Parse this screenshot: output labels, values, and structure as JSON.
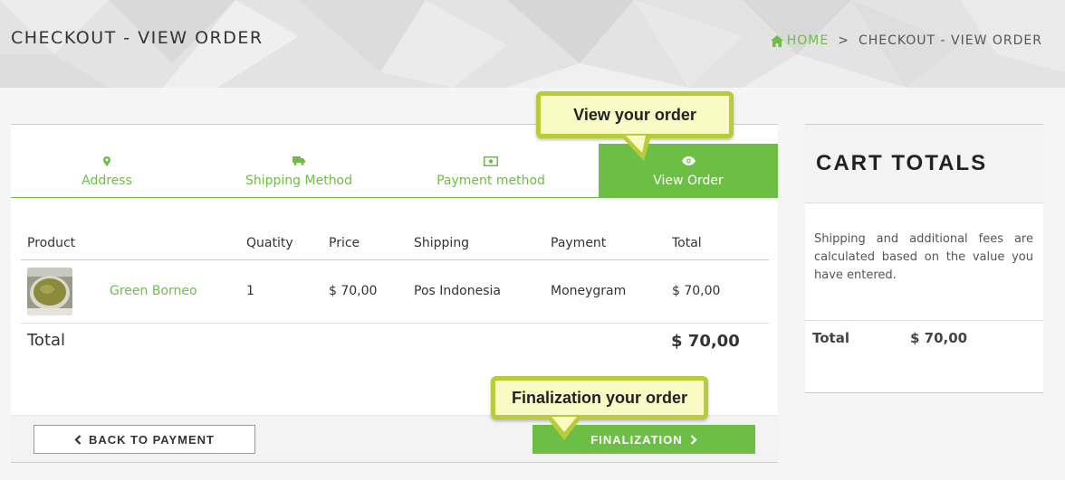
{
  "header": {
    "title": "CHECKOUT - VIEW ORDER",
    "breadcrumb": {
      "home": "HOME",
      "separator": ">",
      "current": "CHECKOUT - VIEW ORDER"
    }
  },
  "steps": [
    {
      "label": "Address",
      "icon": "map-marker-icon",
      "active": false
    },
    {
      "label": "Shipping Method",
      "icon": "truck-icon",
      "active": false
    },
    {
      "label": "Payment method",
      "icon": "money-icon",
      "active": false
    },
    {
      "label": "View Order",
      "icon": "eye-icon",
      "active": true
    }
  ],
  "table": {
    "headers": {
      "product": "Product",
      "quantity": "Quatity",
      "price": "Price",
      "shipping": "Shipping",
      "payment": "Payment",
      "total": "Total"
    },
    "rows": [
      {
        "product": "Green Borneo",
        "quantity": "1",
        "price": "$ 70,00",
        "shipping": "Pos Indonesia",
        "payment": "Moneygram",
        "total": "$ 70,00"
      }
    ]
  },
  "order_total": {
    "label": "Total",
    "value": "$ 70,00"
  },
  "buttons": {
    "back": "BACK TO PAYMENT",
    "finalize": "FINALIZATION"
  },
  "tooltips": {
    "view_order": "View your order",
    "finalization": "Finalization your order"
  },
  "cart_totals": {
    "title": "CART TOTALS",
    "note": "Shipping and additional fees are calculated based on the value you have entered.",
    "total_label": "Total",
    "total_value": "$ 70,00"
  },
  "colors": {
    "accent": "#6cbf44",
    "tooltip_bg": "#fafac4",
    "tooltip_border": "#b8cc3a"
  }
}
